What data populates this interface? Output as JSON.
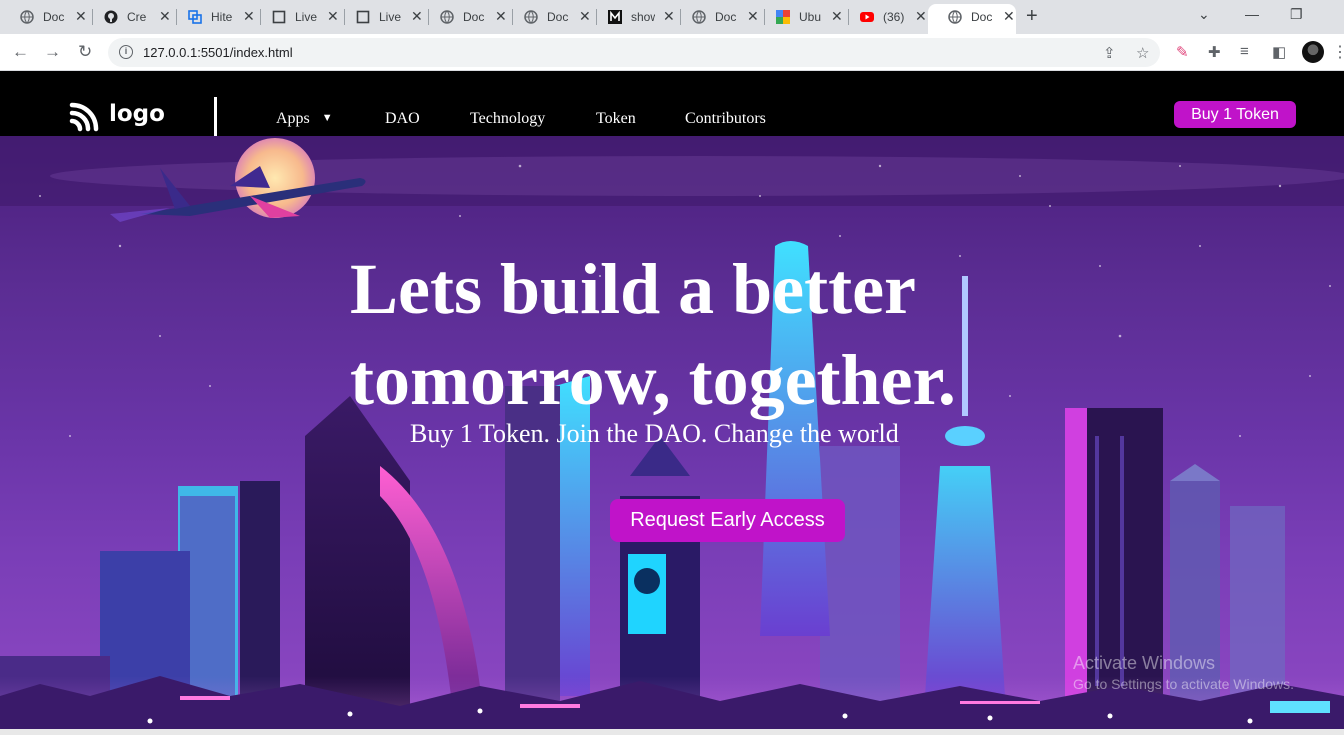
{
  "browser": {
    "tabs": [
      {
        "label": "Doc",
        "icon": "globe-icon"
      },
      {
        "label": "Cre",
        "icon": "github-icon"
      },
      {
        "label": "Hite",
        "icon": "copy-icon"
      },
      {
        "label": "Live",
        "icon": "square-icon"
      },
      {
        "label": "Live",
        "icon": "square-icon"
      },
      {
        "label": "Doc",
        "icon": "globe-icon"
      },
      {
        "label": "Doc",
        "icon": "globe-icon"
      },
      {
        "label": "show",
        "icon": "m-icon"
      },
      {
        "label": "Doc",
        "icon": "globe-icon"
      },
      {
        "label": "Ubu",
        "icon": "puzzle-color-icon"
      },
      {
        "label": "(36)",
        "icon": "youtube-icon"
      },
      {
        "label": "Doc",
        "icon": "globe-icon",
        "active": true
      }
    ],
    "url": "127.0.0.1:5501/index.html"
  },
  "nav": {
    "logo_text": "logo",
    "links": [
      "Apps",
      "DAO",
      "Technology",
      "Token",
      "Contributors"
    ],
    "buy_label": "Buy 1 Token"
  },
  "hero": {
    "headline": "Lets build a better tomorrow, together.",
    "subline": "Buy 1 Token. Join the DAO. Change the world",
    "cta_label": "Request Early Access"
  },
  "watermark": {
    "title": "Activate Windows",
    "subtitle": "Go to Settings to activate Windows."
  },
  "colors": {
    "accent": "#c013c9",
    "nav_bg": "#000000",
    "hero_top": "#4a1f7c",
    "hero_bottom": "#8f49c4"
  }
}
